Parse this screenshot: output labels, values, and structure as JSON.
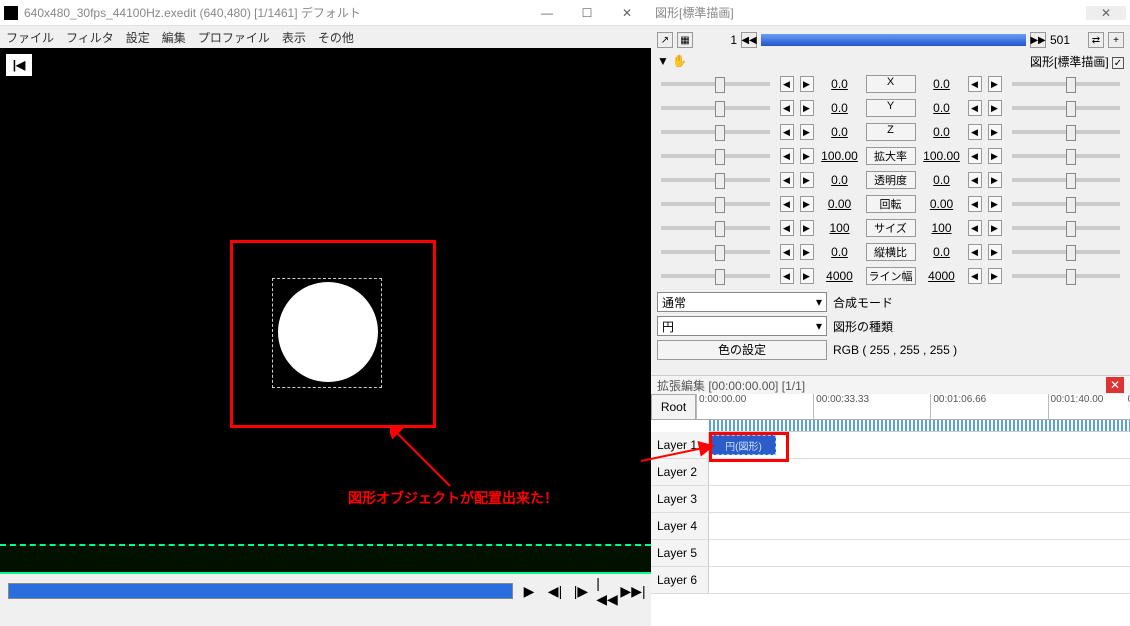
{
  "window": {
    "title": "640x480_30fps_44100Hz.exedit (640,480) [1/1461] デフォルト",
    "buttons": {
      "min": "—",
      "max": "☐",
      "close": "✕"
    }
  },
  "menu": [
    "ファイル",
    "フィルタ",
    "設定",
    "編集",
    "プロファイル",
    "表示",
    "その他"
  ],
  "preview": {
    "home_glyph": "|◀",
    "annotation": "図形オブジェクトが配置出来た！"
  },
  "playbar": {
    "buttons": [
      "▶",
      "◀|",
      "|▶",
      "|◀◀",
      "▶▶|"
    ]
  },
  "propPanel": {
    "title": "図形[標準描画]",
    "frame_left": "1",
    "frame_right": "501",
    "tree_label": "図形[標準描画]",
    "rows": [
      {
        "name": "X",
        "l": "0.0",
        "r": "0.0"
      },
      {
        "name": "Y",
        "l": "0.0",
        "r": "0.0"
      },
      {
        "name": "Z",
        "l": "0.0",
        "r": "0.0"
      },
      {
        "name": "拡大率",
        "l": "100.00",
        "r": "100.00"
      },
      {
        "name": "透明度",
        "l": "0.0",
        "r": "0.0"
      },
      {
        "name": "回転",
        "l": "0.00",
        "r": "0.00"
      },
      {
        "name": "サイズ",
        "l": "100",
        "r": "100"
      },
      {
        "name": "縦横比",
        "l": "0.0",
        "r": "0.0"
      },
      {
        "name": "ライン幅",
        "l": "4000",
        "r": "4000"
      }
    ],
    "blend_mode_label": "合成モード",
    "blend_mode_value": "通常",
    "shape_type_label": "図形の種類",
    "shape_type_value": "円",
    "color_button": "色の設定",
    "rgb": "RGB ( 255 , 255 , 255 )"
  },
  "timeline": {
    "title": "拡張編集 [00:00:00.00] [1/1]",
    "root": "Root",
    "ticks": [
      "0:00:00.00",
      "00:00:33.33",
      "00:01:06.66",
      "00:01:40.00",
      "0"
    ],
    "layers": [
      "Layer 1",
      "Layer 2",
      "Layer 3",
      "Layer 4",
      "Layer 5",
      "Layer 6"
    ],
    "clip": "円(図形)"
  }
}
